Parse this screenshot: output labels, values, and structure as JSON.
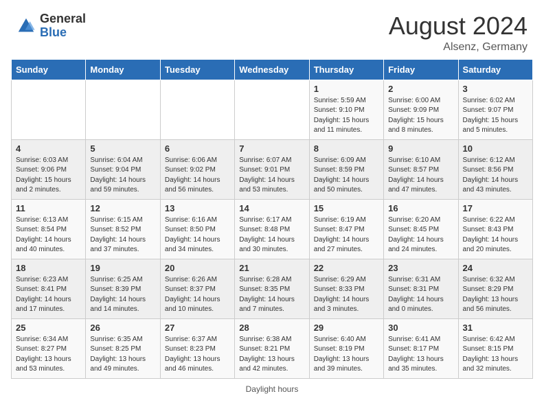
{
  "header": {
    "logo_general": "General",
    "logo_blue": "Blue",
    "month_year": "August 2024",
    "location": "Alsenz, Germany"
  },
  "days_of_week": [
    "Sunday",
    "Monday",
    "Tuesday",
    "Wednesday",
    "Thursday",
    "Friday",
    "Saturday"
  ],
  "footer": {
    "note": "Daylight hours"
  },
  "weeks": [
    [
      {
        "day": "",
        "sunrise": "",
        "sunset": "",
        "daylight": ""
      },
      {
        "day": "",
        "sunrise": "",
        "sunset": "",
        "daylight": ""
      },
      {
        "day": "",
        "sunrise": "",
        "sunset": "",
        "daylight": ""
      },
      {
        "day": "",
        "sunrise": "",
        "sunset": "",
        "daylight": ""
      },
      {
        "day": "1",
        "sunrise": "Sunrise: 5:59 AM",
        "sunset": "Sunset: 9:10 PM",
        "daylight": "Daylight: 15 hours and 11 minutes."
      },
      {
        "day": "2",
        "sunrise": "Sunrise: 6:00 AM",
        "sunset": "Sunset: 9:09 PM",
        "daylight": "Daylight: 15 hours and 8 minutes."
      },
      {
        "day": "3",
        "sunrise": "Sunrise: 6:02 AM",
        "sunset": "Sunset: 9:07 PM",
        "daylight": "Daylight: 15 hours and 5 minutes."
      }
    ],
    [
      {
        "day": "4",
        "sunrise": "Sunrise: 6:03 AM",
        "sunset": "Sunset: 9:06 PM",
        "daylight": "Daylight: 15 hours and 2 minutes."
      },
      {
        "day": "5",
        "sunrise": "Sunrise: 6:04 AM",
        "sunset": "Sunset: 9:04 PM",
        "daylight": "Daylight: 14 hours and 59 minutes."
      },
      {
        "day": "6",
        "sunrise": "Sunrise: 6:06 AM",
        "sunset": "Sunset: 9:02 PM",
        "daylight": "Daylight: 14 hours and 56 minutes."
      },
      {
        "day": "7",
        "sunrise": "Sunrise: 6:07 AM",
        "sunset": "Sunset: 9:01 PM",
        "daylight": "Daylight: 14 hours and 53 minutes."
      },
      {
        "day": "8",
        "sunrise": "Sunrise: 6:09 AM",
        "sunset": "Sunset: 8:59 PM",
        "daylight": "Daylight: 14 hours and 50 minutes."
      },
      {
        "day": "9",
        "sunrise": "Sunrise: 6:10 AM",
        "sunset": "Sunset: 8:57 PM",
        "daylight": "Daylight: 14 hours and 47 minutes."
      },
      {
        "day": "10",
        "sunrise": "Sunrise: 6:12 AM",
        "sunset": "Sunset: 8:56 PM",
        "daylight": "Daylight: 14 hours and 43 minutes."
      }
    ],
    [
      {
        "day": "11",
        "sunrise": "Sunrise: 6:13 AM",
        "sunset": "Sunset: 8:54 PM",
        "daylight": "Daylight: 14 hours and 40 minutes."
      },
      {
        "day": "12",
        "sunrise": "Sunrise: 6:15 AM",
        "sunset": "Sunset: 8:52 PM",
        "daylight": "Daylight: 14 hours and 37 minutes."
      },
      {
        "day": "13",
        "sunrise": "Sunrise: 6:16 AM",
        "sunset": "Sunset: 8:50 PM",
        "daylight": "Daylight: 14 hours and 34 minutes."
      },
      {
        "day": "14",
        "sunrise": "Sunrise: 6:17 AM",
        "sunset": "Sunset: 8:48 PM",
        "daylight": "Daylight: 14 hours and 30 minutes."
      },
      {
        "day": "15",
        "sunrise": "Sunrise: 6:19 AM",
        "sunset": "Sunset: 8:47 PM",
        "daylight": "Daylight: 14 hours and 27 minutes."
      },
      {
        "day": "16",
        "sunrise": "Sunrise: 6:20 AM",
        "sunset": "Sunset: 8:45 PM",
        "daylight": "Daylight: 14 hours and 24 minutes."
      },
      {
        "day": "17",
        "sunrise": "Sunrise: 6:22 AM",
        "sunset": "Sunset: 8:43 PM",
        "daylight": "Daylight: 14 hours and 20 minutes."
      }
    ],
    [
      {
        "day": "18",
        "sunrise": "Sunrise: 6:23 AM",
        "sunset": "Sunset: 8:41 PM",
        "daylight": "Daylight: 14 hours and 17 minutes."
      },
      {
        "day": "19",
        "sunrise": "Sunrise: 6:25 AM",
        "sunset": "Sunset: 8:39 PM",
        "daylight": "Daylight: 14 hours and 14 minutes."
      },
      {
        "day": "20",
        "sunrise": "Sunrise: 6:26 AM",
        "sunset": "Sunset: 8:37 PM",
        "daylight": "Daylight: 14 hours and 10 minutes."
      },
      {
        "day": "21",
        "sunrise": "Sunrise: 6:28 AM",
        "sunset": "Sunset: 8:35 PM",
        "daylight": "Daylight: 14 hours and 7 minutes."
      },
      {
        "day": "22",
        "sunrise": "Sunrise: 6:29 AM",
        "sunset": "Sunset: 8:33 PM",
        "daylight": "Daylight: 14 hours and 3 minutes."
      },
      {
        "day": "23",
        "sunrise": "Sunrise: 6:31 AM",
        "sunset": "Sunset: 8:31 PM",
        "daylight": "Daylight: 14 hours and 0 minutes."
      },
      {
        "day": "24",
        "sunrise": "Sunrise: 6:32 AM",
        "sunset": "Sunset: 8:29 PM",
        "daylight": "Daylight: 13 hours and 56 minutes."
      }
    ],
    [
      {
        "day": "25",
        "sunrise": "Sunrise: 6:34 AM",
        "sunset": "Sunset: 8:27 PM",
        "daylight": "Daylight: 13 hours and 53 minutes."
      },
      {
        "day": "26",
        "sunrise": "Sunrise: 6:35 AM",
        "sunset": "Sunset: 8:25 PM",
        "daylight": "Daylight: 13 hours and 49 minutes."
      },
      {
        "day": "27",
        "sunrise": "Sunrise: 6:37 AM",
        "sunset": "Sunset: 8:23 PM",
        "daylight": "Daylight: 13 hours and 46 minutes."
      },
      {
        "day": "28",
        "sunrise": "Sunrise: 6:38 AM",
        "sunset": "Sunset: 8:21 PM",
        "daylight": "Daylight: 13 hours and 42 minutes."
      },
      {
        "day": "29",
        "sunrise": "Sunrise: 6:40 AM",
        "sunset": "Sunset: 8:19 PM",
        "daylight": "Daylight: 13 hours and 39 minutes."
      },
      {
        "day": "30",
        "sunrise": "Sunrise: 6:41 AM",
        "sunset": "Sunset: 8:17 PM",
        "daylight": "Daylight: 13 hours and 35 minutes."
      },
      {
        "day": "31",
        "sunrise": "Sunrise: 6:42 AM",
        "sunset": "Sunset: 8:15 PM",
        "daylight": "Daylight: 13 hours and 32 minutes."
      }
    ]
  ]
}
